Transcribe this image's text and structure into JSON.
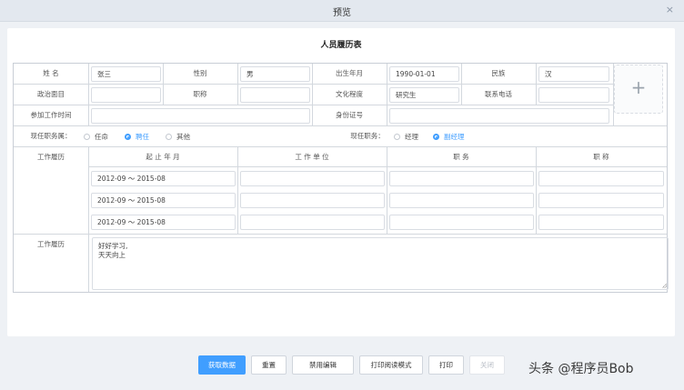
{
  "window": {
    "title": "预览",
    "close": "×"
  },
  "form": {
    "title": "人员履历表",
    "fields": {
      "name_label": "姓 名",
      "name_value": "张三",
      "gender_label": "性别",
      "gender_value": "男",
      "birth_label": "出生年月",
      "birth_value": "1990-01-01",
      "nation_label": "民族",
      "nation_value": "汉",
      "politics_label": "政治面目",
      "politics_value": "",
      "title_label": "职称",
      "title_value": "",
      "education_label": "文化程度",
      "education_value": "研究生",
      "phone_label": "联系电话",
      "phone_value": "",
      "workstart_label": "参加工作时间",
      "workstart_value": "",
      "idcard_label": "身份证号",
      "idcard_value": ""
    },
    "photo_upload": {
      "icon": "+"
    },
    "job_category": {
      "label": "现任职务属：",
      "options": [
        "任命",
        "聘任",
        "其他"
      ],
      "selected": "聘任"
    },
    "current_job": {
      "label": "现任职务：",
      "options": [
        "经理",
        "副经理"
      ],
      "selected": "副经理"
    },
    "history": {
      "label": "工作履历",
      "columns": [
        "起 止 年 月",
        "工 作 单 位",
        "职 务",
        "职 称"
      ],
      "rows": [
        {
          "period": "2012-09 ～ 2015-08",
          "unit": "",
          "position": "",
          "title": ""
        },
        {
          "period": "2012-09 ～ 2015-08",
          "unit": "",
          "position": "",
          "title": ""
        },
        {
          "period": "2012-09 ～ 2015-08",
          "unit": "",
          "position": "",
          "title": ""
        }
      ]
    },
    "experience": {
      "label": "工作履历",
      "lines": [
        "好好学习,",
        "天天向上"
      ]
    }
  },
  "buttons": {
    "get_data": "获取数据",
    "reset": "重置",
    "disable_edit": "禁用编辑",
    "print_read_mode": "打印阅读模式",
    "print": "打印",
    "close": "关闭"
  },
  "watermark": "头条 @程序员Bob",
  "colors": {
    "accent": "#409eff",
    "border": "#c9ced6",
    "background": "#eef1f5"
  }
}
